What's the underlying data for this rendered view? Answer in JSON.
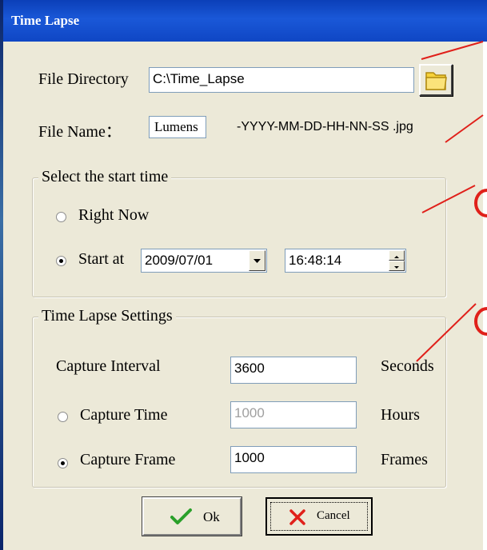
{
  "window": {
    "title": "Time Lapse"
  },
  "file": {
    "directory_label": "File Directory",
    "directory_value": "C:\\Time_Lapse",
    "name_label": "File Name：",
    "name_value": "Lumens",
    "name_suffix": "-YYYY-MM-DD-HH-NN-SS .jpg"
  },
  "start_time": {
    "legend": "Select the start time",
    "right_now_label": "Right Now",
    "start_at_label": "Start at",
    "date_value": "2009/07/01",
    "time_value": "16:48:14",
    "selected": "start_at"
  },
  "settings": {
    "legend": "Time Lapse Settings",
    "interval_label": "Capture Interval",
    "interval_value": "3600",
    "interval_unit": "Seconds",
    "time_label": "Capture Time",
    "time_value": "1000",
    "time_unit": "Hours",
    "frame_label": "Capture Frame",
    "frame_value": "1000",
    "frame_unit": "Frames",
    "selected": "capture_frame"
  },
  "buttons": {
    "ok_label": "Ok",
    "cancel_label": "Cancel"
  },
  "annotations": {
    "color": "#e0201a"
  },
  "icons": [
    "folder-icon",
    "dropdown-arrow-icon",
    "spinner-up-icon",
    "spinner-down-icon",
    "check-icon",
    "x-icon"
  ]
}
